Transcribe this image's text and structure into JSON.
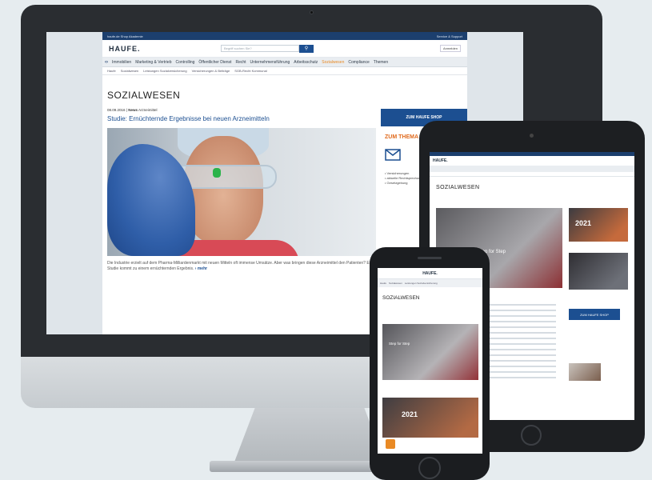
{
  "desktop": {
    "topbar_left": "haufe.de  Shop  Akademie",
    "topbar_right": "Service & Support",
    "logo": "HAUFE.",
    "search_placeholder": "Begriff suchen Sie?",
    "login_label": "Anmelden",
    "nav_items": [
      "Immobilien",
      "Marketing & Vertrieb",
      "Controlling",
      "Öffentlicher Dienst",
      "Recht",
      "Unternehmensführung",
      "Arbeitsschutz",
      "Sozialwesen",
      "Compliance",
      "Themen"
    ],
    "nav_active": "Sozialwesen",
    "subnav_items": [
      "Haufe",
      "Sozialwesen",
      "Leistungen Sozialversicherung",
      "Versicherungen & Beiträge",
      "SGB-Recht Kommunal"
    ],
    "section_title": "SOZIALWESEN",
    "date": "08.09.2016",
    "category": "News",
    "topic": "Arzneimittel",
    "headline": "Studie: Ernüchternde Ergebnisse bei neuen Arzneimitteln",
    "teaser": "Die Industrie erzielt auf dem Pharma-Milliardenmarkt mit neuen Mitteln oft immense Umsätze. Aber was bringen diese Arzneimittel den Patienten? Eine Studie kommt zu einem ernüchternden Ergebnis.",
    "more": "mehr",
    "shop_button": "ZUM HAUFE SHOP",
    "theme_title": "ZUM THEMA",
    "sidebar_bullets": [
      "Versicherungen",
      "aktuelle Rechtsprechung",
      "Gesetzgebung"
    ]
  },
  "tablet": {
    "logo": "HAUFE.",
    "section_title": "SOZIALWESEN",
    "overlay_text": "Step for Step",
    "year_label": "2021",
    "button_label": "ZUM HAUFE SHOP"
  },
  "phone": {
    "logo": "HAUFE.",
    "subnav_items": [
      "Haufe",
      "Sozialwesen",
      "Leistungen Sozialversicherung"
    ],
    "section_title": "SOZIALWESEN",
    "overlay_text": "Step for Step",
    "year_label": "2021"
  },
  "colors": {
    "brand_blue": "#1c4f91",
    "dark_blue": "#1c3f6e",
    "accent_orange": "#e98a25"
  }
}
